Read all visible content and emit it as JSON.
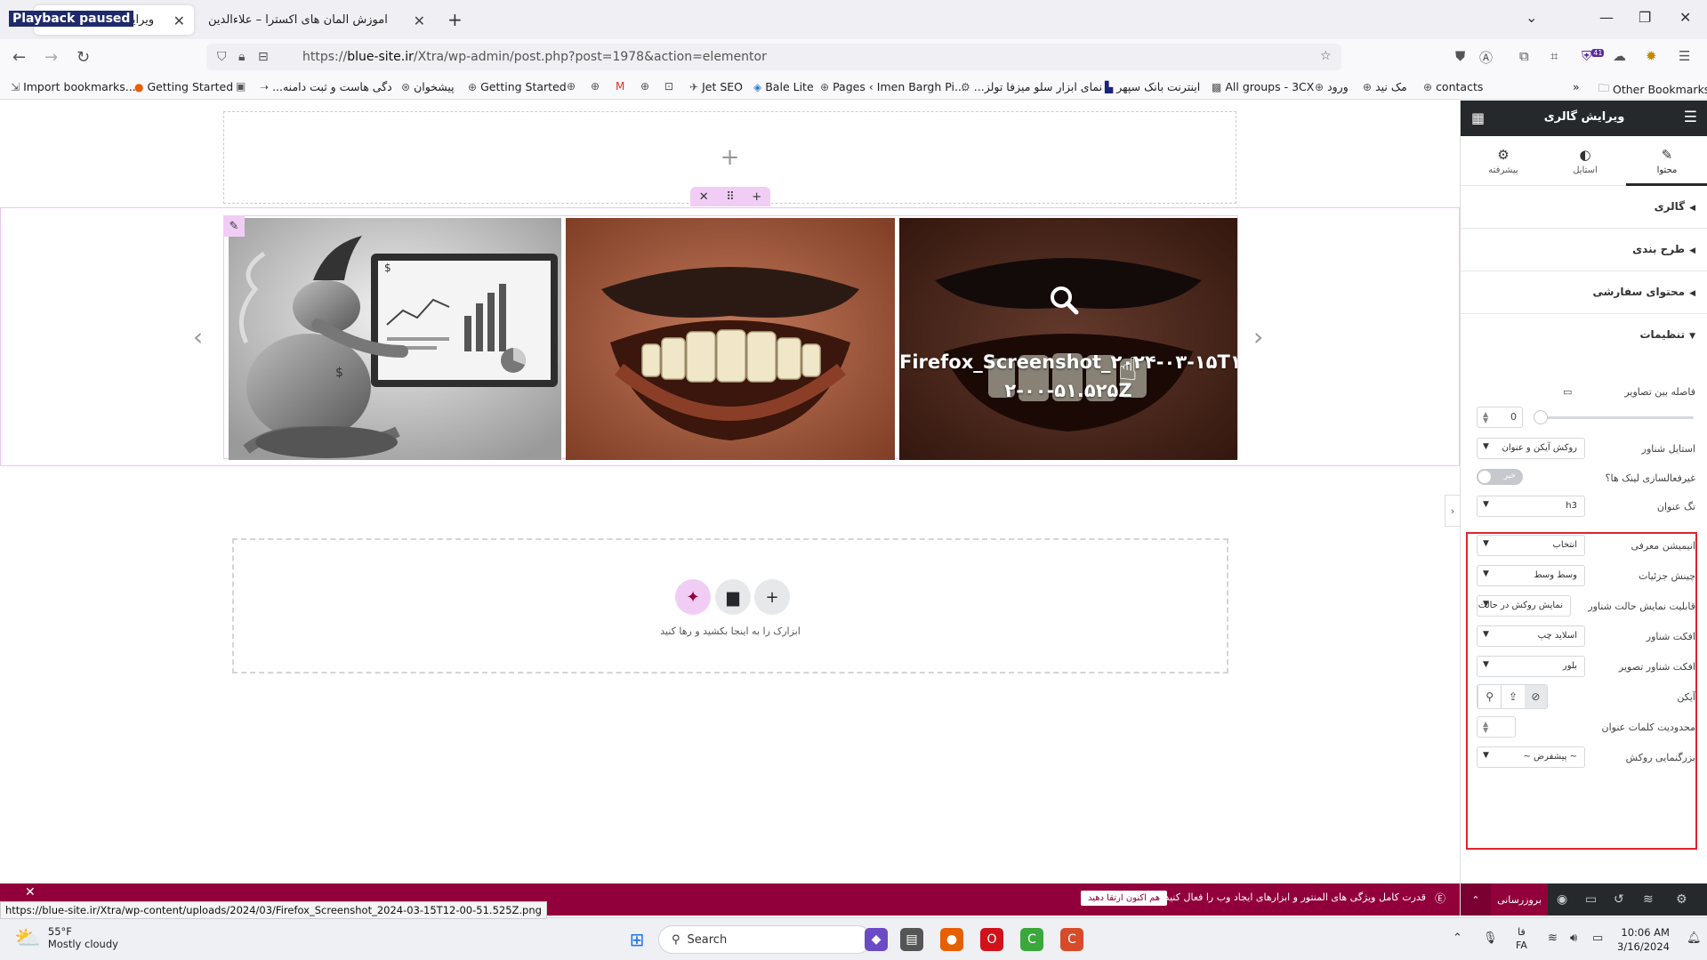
{
  "browser": {
    "playback_badge": "Playback paused",
    "tabs": [
      {
        "label": "ویرایش \"آموزش المان",
        "active": true
      },
      {
        "label": "آموزش المان های اکسترا – علاءالدین",
        "active": false
      }
    ],
    "url": {
      "prefix": "https://",
      "host": "blue-site.ir",
      "path": "/Xtra/wp-admin/post.php?post=1978&action=elementor"
    },
    "extension_badge": "41",
    "bookmarks": [
      {
        "label": "Import bookmarks...",
        "icon": "import-icon"
      },
      {
        "label": "Getting Started",
        "icon": "firefox-icon"
      },
      {
        "label": "",
        "icon": "calendar-icon"
      },
      {
        "label": "...دگی هاست و ثبت دامنه",
        "icon": "arrow-icon"
      },
      {
        "label": "پیشخوان",
        "icon": "wordpress-icon"
      },
      {
        "label": "Getting Started",
        "icon": "globe-icon"
      },
      {
        "label": "",
        "icon": "globe-icon"
      },
      {
        "label": "",
        "icon": "globe-icon"
      },
      {
        "label": "",
        "icon": "gmail-icon"
      },
      {
        "label": "",
        "icon": "globe-icon"
      },
      {
        "label": "",
        "icon": "globe-icon"
      },
      {
        "label": "Jet SEO",
        "icon": "rocket-icon"
      },
      {
        "label": "Bale Lite",
        "icon": "bale-icon"
      },
      {
        "label": "Pages ‹ Imen Bargh Pi...",
        "icon": "globe-icon"
      },
      {
        "label": "...نمای ابزار سلو میزفا تولز",
        "icon": "gear-icon"
      },
      {
        "label": "اینترنت بانک سپهر",
        "icon": "bank-icon"
      },
      {
        "label": "All groups - 3CX",
        "icon": "3cx-icon"
      },
      {
        "label": "ورود",
        "icon": "globe-icon"
      },
      {
        "label": "مک نید",
        "icon": "globe-icon"
      },
      {
        "label": "contacts",
        "icon": "globe-icon"
      }
    ],
    "overflow": "»",
    "other_bookmarks": "Other Bookmarks"
  },
  "canvas": {
    "gallery": {
      "overlay_title_line1": "Firefox_Screenshot_۲۰۲۴-۰۳-۱۵T۱",
      "overlay_title_line2": "۲-۰۰-۵۱.۵۲۵Z"
    },
    "dropzone_text": "ابزارک را به اینجا بکشید و رها کنید"
  },
  "notice_bar": {
    "message": "قدرت کامل ویژگی های المنتور و ابزارهای ایجاد وب را فعال کنید.",
    "cta": "هم اکنون ارتقا دهید"
  },
  "status_url": "https://blue-site.ir/Xtra/wp-content/uploads/2024/03/Firefox_Screenshot_2024-03-15T12-00-51.525Z.png",
  "panel": {
    "title": "ویرایش گالری",
    "tabs": [
      {
        "label": "محتوا",
        "icon": "pencil-icon",
        "active": true
      },
      {
        "label": "استایل",
        "icon": "half-circle-icon",
        "active": false
      },
      {
        "label": "پیشرفته",
        "icon": "gear-icon",
        "active": false
      }
    ],
    "sections": [
      {
        "label": "گالری",
        "open": false
      },
      {
        "label": "طرح بندی",
        "open": false
      },
      {
        "label": "محتوای سفارشی",
        "open": false
      },
      {
        "label": "تنظیمات",
        "open": true
      }
    ],
    "settings": {
      "gap_label": "فاصله بین تصاویر",
      "gap_value": "0",
      "overlay_style_label": "استایل شناور",
      "overlay_style_value": "روکش آیکن و عنوان",
      "disable_link_label": "غیرفعالسازی لینک ها؟",
      "disable_link_value": "خیر",
      "title_tag_label": "تگ عنوان",
      "title_tag_value": "h3",
      "intro_anim_label": "انیمیشن معرفی",
      "intro_anim_value": "انتخاب",
      "detail_align_label": "چینش جزئیات",
      "detail_align_value": "وسط وسط",
      "hover_mode_label": "قابلیت نمایش حالت شناور",
      "hover_mode_value": "نمایش روکش در حالت ش",
      "hover_effect_label": "افکت شناور",
      "hover_effect_value": "اسلاید چپ",
      "image_hover_label": "افکت شناور تصویر",
      "image_hover_value": "بلور",
      "icon_label": "آیکن",
      "title_words_label": "محدودیت کلمات عنوان",
      "title_words_value": "",
      "lightbox_label": "بزرگنمایی روکش",
      "lightbox_value": "~ پیشفرض ~"
    },
    "publish_label": "بروزرسانی"
  },
  "taskbar": {
    "weather_temp": "55°F",
    "weather_desc": "Mostly cloudy",
    "search_label": "Search",
    "lang_top": "فا",
    "lang_bottom": "FA",
    "time": "10:06 AM",
    "date": "3/16/2024"
  },
  "colors": {
    "elementor_dark": "#26292c",
    "elementor_maroon": "#92003b",
    "handle_pink": "#f1cdf5",
    "highlight_red": "#e0242e"
  }
}
